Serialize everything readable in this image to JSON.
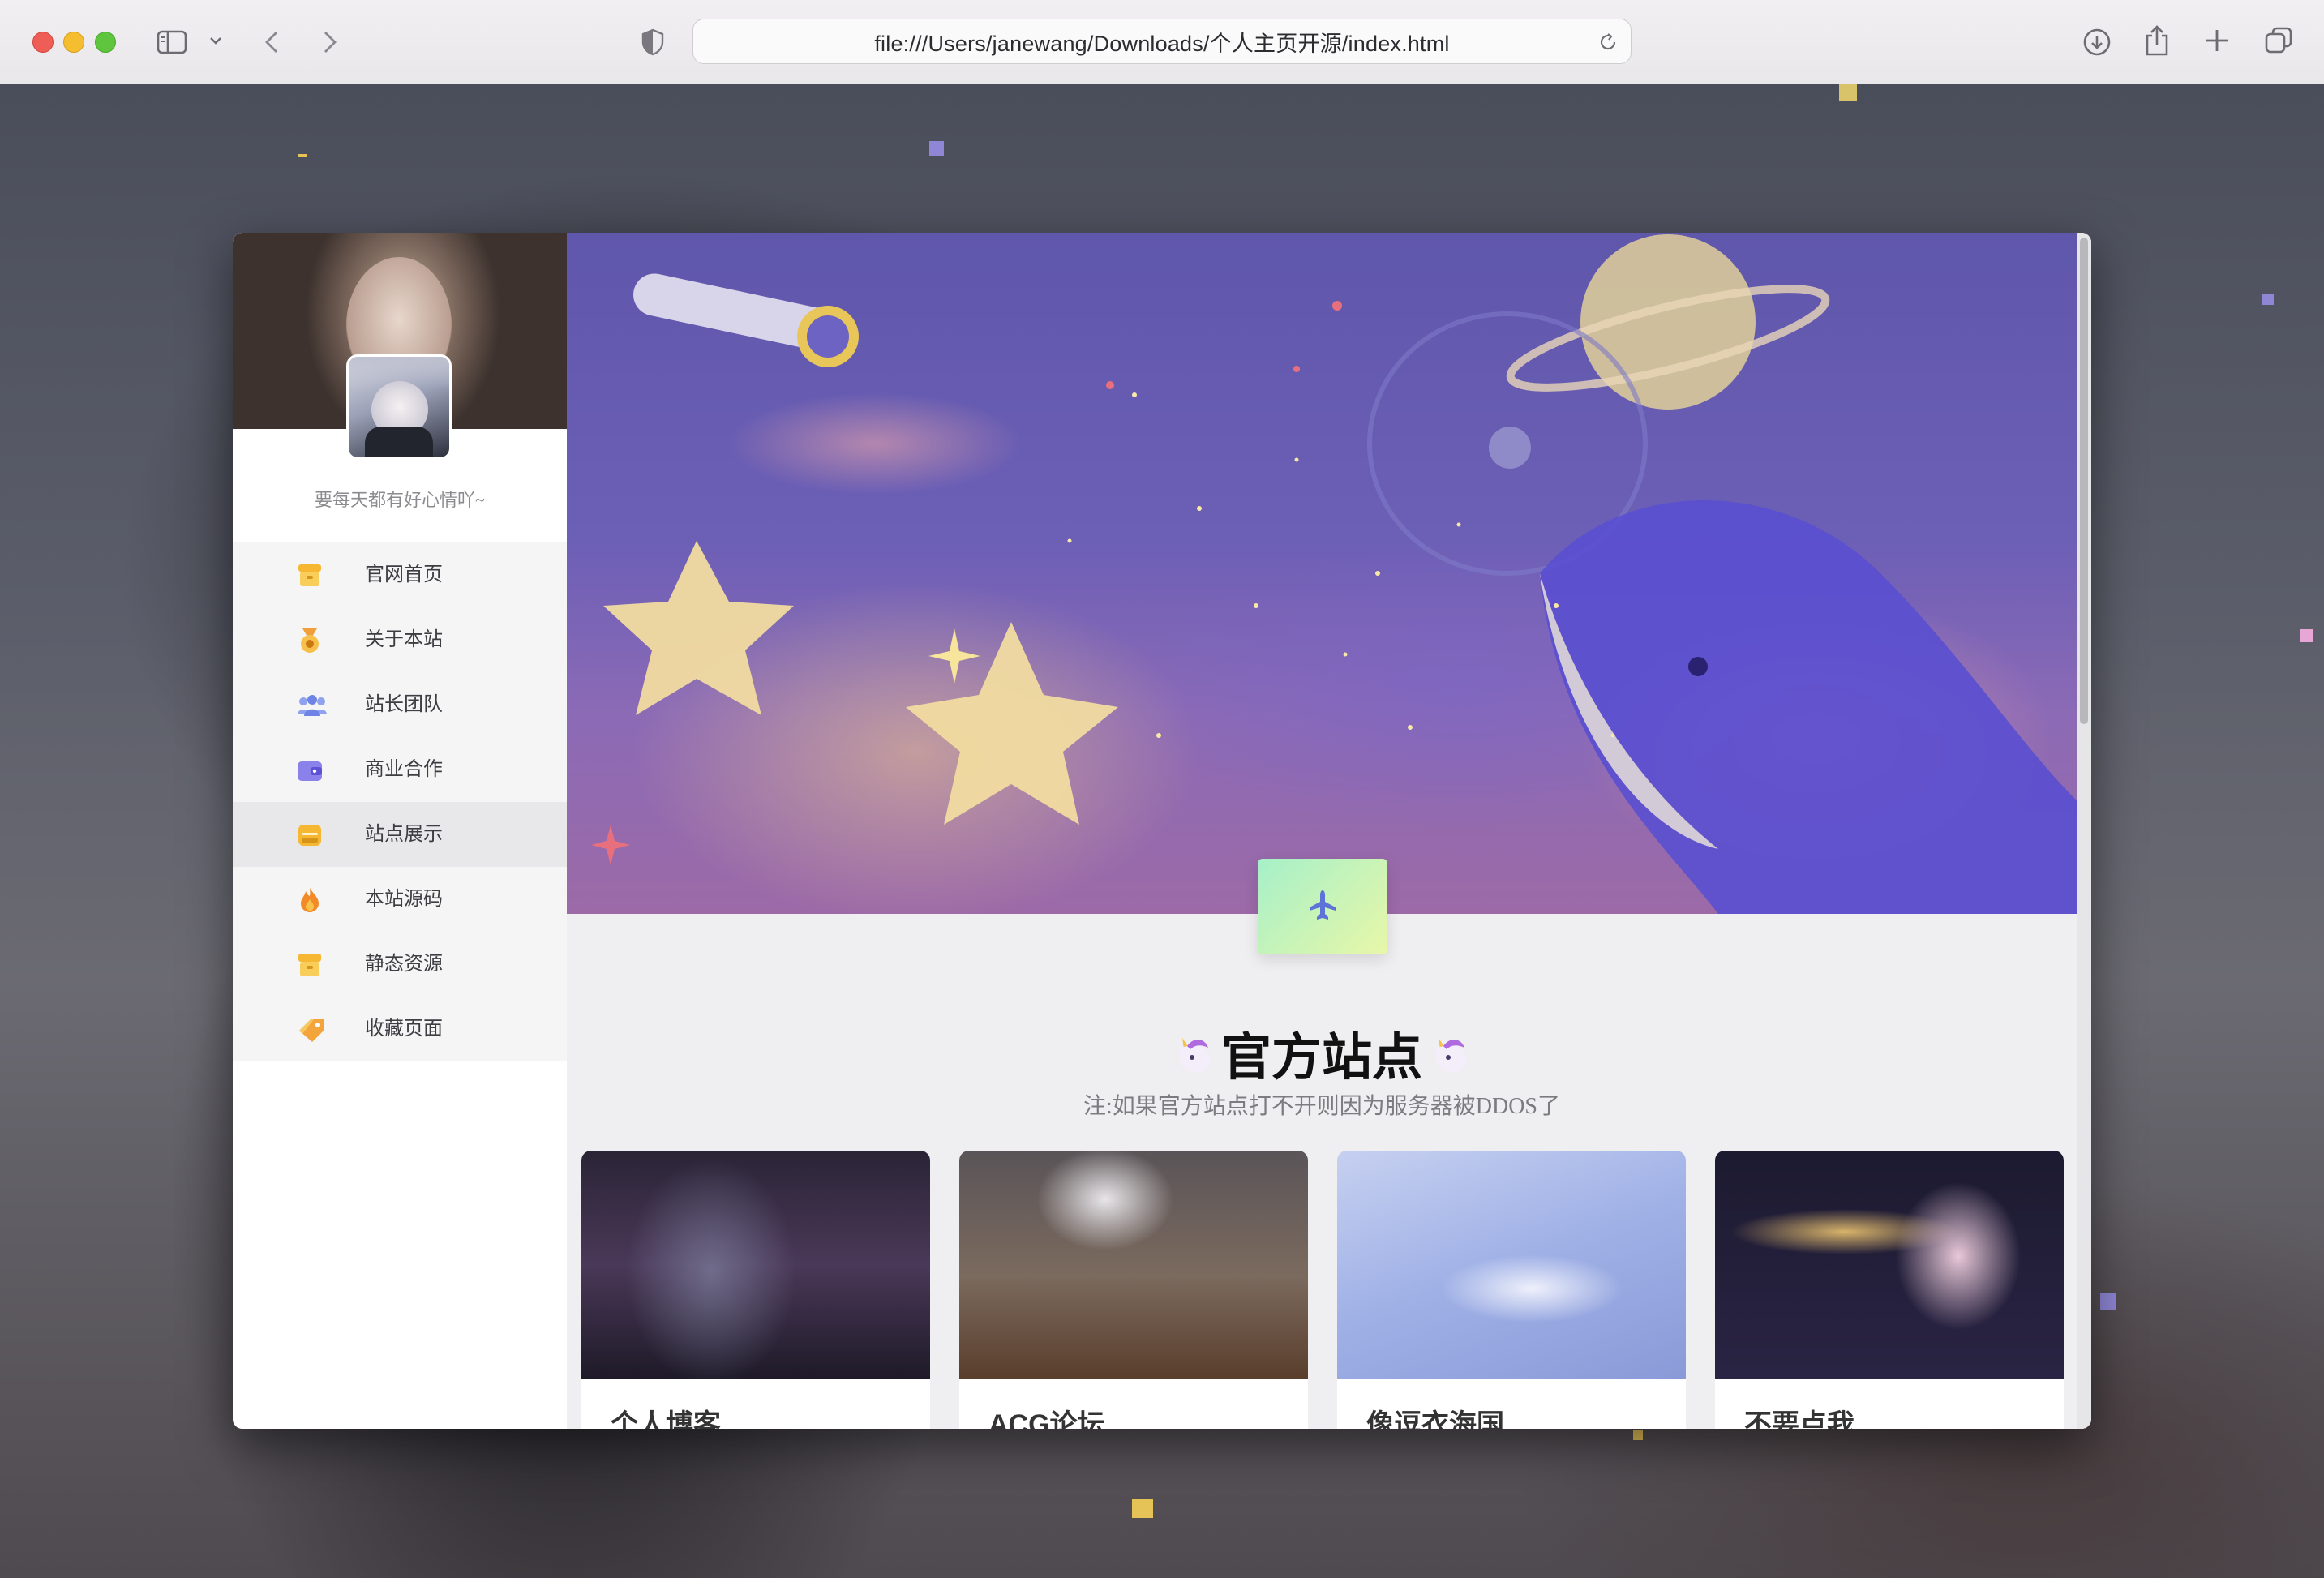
{
  "browser": {
    "address": "file:///Users/janewang/Downloads/个人主页开源/index.html",
    "icons": [
      "sidebar-icon",
      "chevron-down-icon",
      "back-icon",
      "forward-icon",
      "shield-icon",
      "reload-icon",
      "download-icon",
      "share-icon",
      "new-tab-icon",
      "tabs-overview-icon"
    ]
  },
  "sidebar": {
    "tagline": "要每天都有好心情吖~",
    "items": [
      {
        "label": "官网首页",
        "icon": "home-box-icon",
        "active": false
      },
      {
        "label": "关于本站",
        "icon": "medal-icon",
        "active": false
      },
      {
        "label": "站长团队",
        "icon": "team-icon",
        "active": false
      },
      {
        "label": "商业合作",
        "icon": "wallet-icon",
        "active": false
      },
      {
        "label": "站点展示",
        "icon": "display-box-icon",
        "active": true
      },
      {
        "label": "本站源码",
        "icon": "flame-icon",
        "active": false
      },
      {
        "label": "静态资源",
        "icon": "storage-box-icon",
        "active": false
      },
      {
        "label": "收藏页面",
        "icon": "tag-icon",
        "active": false
      }
    ]
  },
  "main": {
    "section_title": "官方站点",
    "section_note": "注:如果官方站点打不开则因为服务器被DDOS了",
    "sites": [
      {
        "title": "个人博客"
      },
      {
        "title": "ACG论坛"
      },
      {
        "title": "像逗衣海国"
      },
      {
        "title": "不要点我"
      }
    ]
  },
  "colors": {
    "accent_green": "#a6f0c9",
    "accent_yellow": "#e8f7a8",
    "banner_purple": "#6c5fb6",
    "menu_active_bg": "#e8e8ea"
  }
}
